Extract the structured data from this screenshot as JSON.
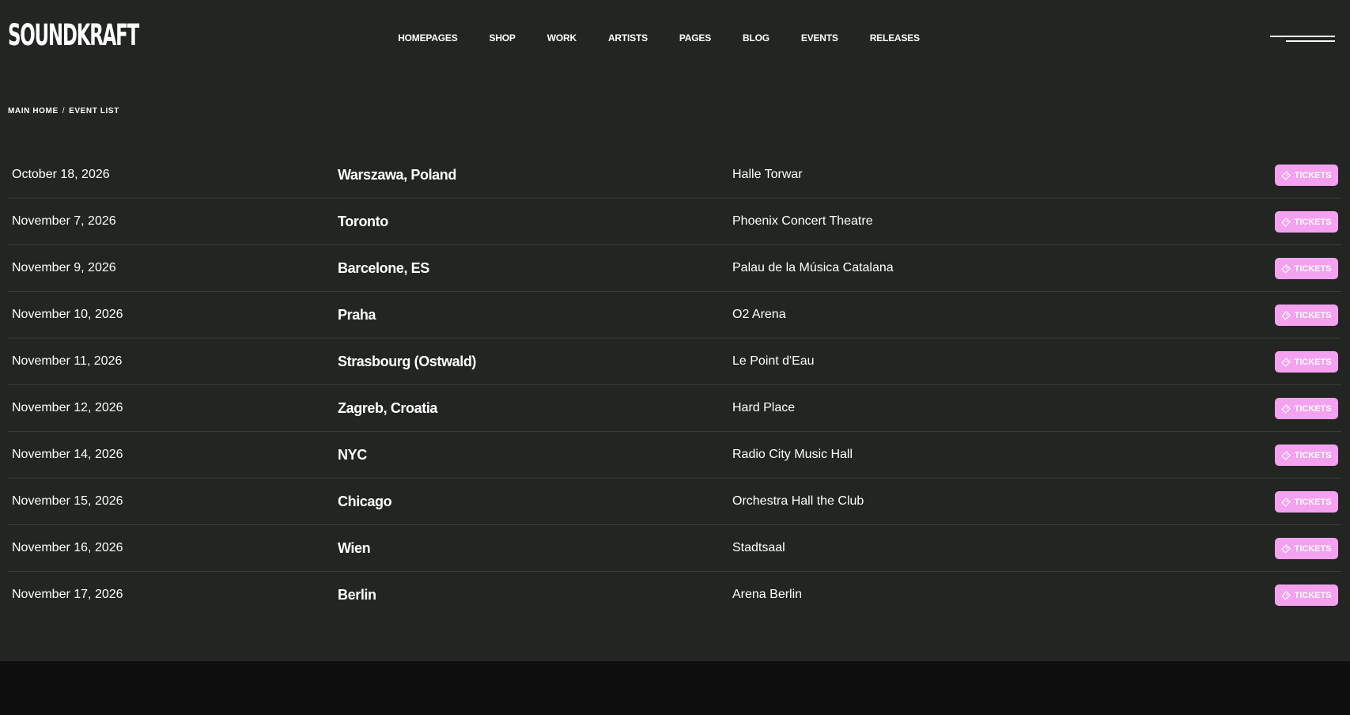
{
  "header": {
    "logo": "SOUNDKRAFT",
    "nav": [
      "HOMEPAGES",
      "SHOP",
      "WORK",
      "ARTISTS",
      "PAGES",
      "BLOG",
      "EVENTS",
      "RELEASES"
    ],
    "menu_icon": "hamburger-icon"
  },
  "breadcrumb": {
    "home": "MAIN HOME",
    "separator": "/",
    "current": "EVENT LIST"
  },
  "events": [
    {
      "date": "October 18, 2026",
      "city": "Warszawa, Poland",
      "venue": "Halle Torwar",
      "button": "TICKETS"
    },
    {
      "date": "November 7, 2026",
      "city": "Toronto",
      "venue": "Phoenix Concert Theatre",
      "button": "TICKETS"
    },
    {
      "date": "November 9, 2026",
      "city": "Barcelone, ES",
      "venue": "Palau de la Música Catalana",
      "button": "TICKETS"
    },
    {
      "date": "November 10, 2026",
      "city": "Praha",
      "venue": "O2 Arena",
      "button": "TICKETS"
    },
    {
      "date": "November 11, 2026",
      "city": "Strasbourg (Ostwald)",
      "venue": "Le Point d'Eau",
      "button": "TICKETS"
    },
    {
      "date": "November 12, 2026",
      "city": "Zagreb, Croatia",
      "venue": "Hard Place",
      "button": "TICKETS"
    },
    {
      "date": "November 14, 2026",
      "city": "NYC",
      "venue": "Radio City Music Hall",
      "button": "TICKETS"
    },
    {
      "date": "November 15, 2026",
      "city": "Chicago",
      "venue": "Orchestra Hall the Club",
      "button": "TICKETS"
    },
    {
      "date": "November 16, 2026",
      "city": "Wien",
      "venue": "Stadtsaal",
      "button": "TICKETS"
    },
    {
      "date": "November 17, 2026",
      "city": "Berlin",
      "venue": "Arena Berlin",
      "button": "TICKETS"
    }
  ],
  "colors": {
    "background": "#222522",
    "footer": "#0d0e0d",
    "accent": "#f4a2f0",
    "divider": "#3a3e3a"
  },
  "icons": {
    "ticket": "ticket-icon"
  }
}
